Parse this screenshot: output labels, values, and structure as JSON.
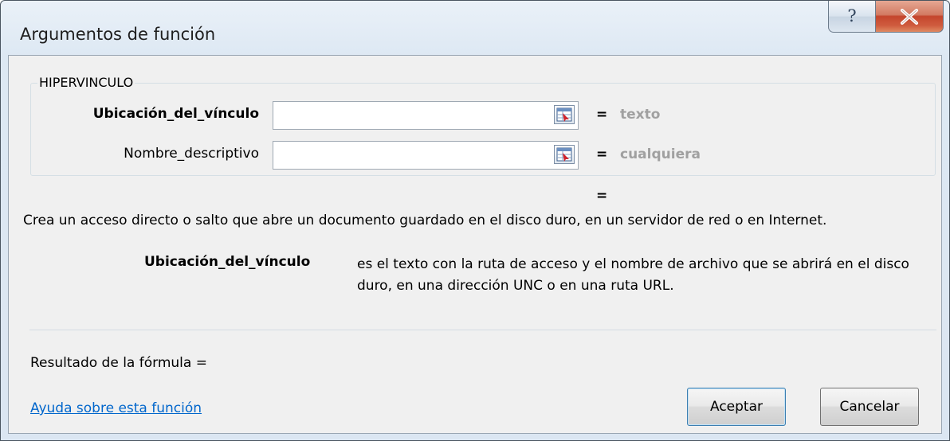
{
  "window": {
    "title": "Argumentos de función",
    "help_glyph": "?",
    "close_glyph": "X"
  },
  "function_group": {
    "name": "HIPERVINCULO",
    "arguments": [
      {
        "label": "Ubicación_del_vínculo",
        "value": "",
        "equals": "=",
        "type_hint": "texto"
      },
      {
        "label": "Nombre_descriptivo",
        "value": "",
        "equals": "=",
        "type_hint": "cualquiera"
      }
    ],
    "result_equals": "="
  },
  "description": "Crea un acceso directo o salto que abre un documento guardado en el disco duro, en un servidor de red o en Internet.",
  "argument_description": {
    "name": "Ubicación_del_vínculo",
    "text": "es el texto con la ruta de acceso y el nombre de archivo que se abrirá en el disco duro, en una dirección UNC o en una ruta URL."
  },
  "formula_result": "Resultado de la fórmula =",
  "help_link": "Ayuda sobre esta función",
  "buttons": {
    "ok": "Aceptar",
    "cancel": "Cancelar"
  },
  "icons": {
    "help": "question-mark-icon",
    "close": "close-x-icon",
    "collapse": "range-collapse-icon"
  },
  "colors": {
    "link": "#0066cc",
    "hint_gray": "#a0a0a0",
    "close_red": "#c4452c"
  }
}
